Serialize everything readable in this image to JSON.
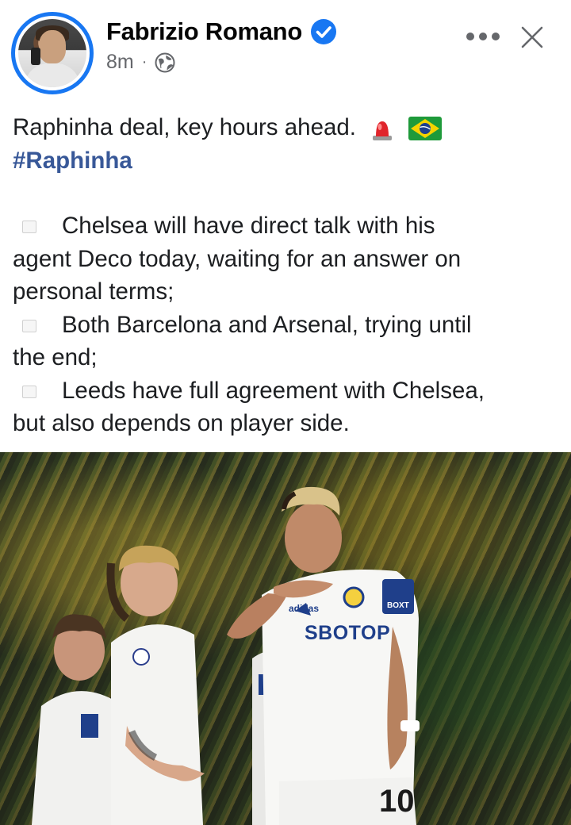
{
  "post": {
    "author": "Fabrizio Romano",
    "time": "8m",
    "separator": "·",
    "text_line1": "Raphinha deal, key hours ahead.",
    "hashtag": "#Raphinha",
    "bullets": [
      {
        "first": "Chelsea will have direct talk with his",
        "rest": [
          "agent Deco today, waiting for an answer on",
          "personal terms;"
        ]
      },
      {
        "first": "Both Barcelona and Arsenal, trying until",
        "rest": [
          "the end;"
        ]
      },
      {
        "first": "Leeds have full agreement with Chelsea,",
        "rest": [
          "but also depends on player side."
        ]
      }
    ]
  },
  "photo": {
    "sponsor_text": "SBOTOP",
    "armband_text": "BOXT",
    "shirt_number": "10",
    "brand_text": "adidas"
  },
  "colors": {
    "verified_blue": "#1877f2",
    "hashtag_color": "#385898",
    "meta_gray": "#65676b"
  },
  "icons": [
    "verified-badge-icon",
    "globe-icon",
    "more-options-icon",
    "close-icon",
    "siren-emoji-icon",
    "brazil-flag-emoji-icon"
  ]
}
